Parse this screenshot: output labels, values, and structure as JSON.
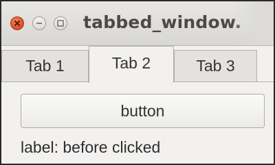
{
  "window": {
    "title": "tabbed_window.",
    "controls": {
      "close_icon": "close-icon",
      "minimize_icon": "minimize-icon",
      "maximize_icon": "maximize-icon"
    }
  },
  "tabs": [
    {
      "label": "Tab 1",
      "active": false
    },
    {
      "label": "Tab 2",
      "active": true
    },
    {
      "label": "Tab 3",
      "active": false
    }
  ],
  "content": {
    "button_label": "button",
    "status_label": "label: before clicked"
  },
  "colors": {
    "close_button": "#e0532b",
    "window_background": "#f2f1f0",
    "titlebar": "#dedddA"
  }
}
